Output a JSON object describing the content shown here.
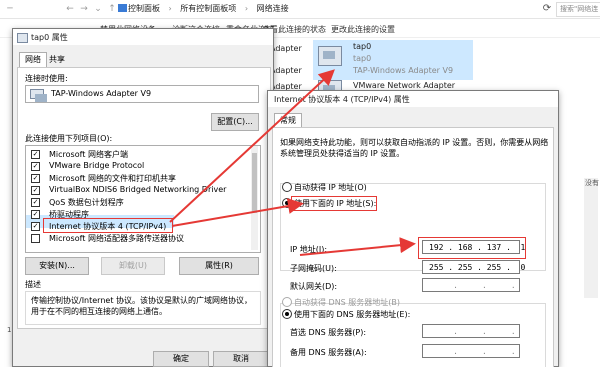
{
  "explorer": {
    "breadcrumb": [
      "控制面板",
      "所有控制面板项",
      "网络连接"
    ],
    "search_placeholder": "搜索\"网络连",
    "commands": [
      "禁用此网络设备",
      "诊断这个连接",
      "重命名此连接",
      "查看此连接的状态",
      "更改此连接的设置"
    ],
    "adapters": [
      {
        "name": "tap0",
        "status": "tap0",
        "device": "TAP-Windows Adapter V9"
      },
      {
        "name": "VMware Network Adapter",
        "status": "",
        "device": ""
      }
    ],
    "left_fragments": [
      "Adapter",
      "Adapter",
      "Adapter"
    ],
    "no_items": "没有",
    "status_num": "1"
  },
  "tap_dialog": {
    "title": "tap0 属性",
    "tabs": [
      "网络",
      "共享"
    ],
    "connect_using_label": "连接时使用:",
    "adapter_name": "TAP-Windows Adapter V9",
    "configure_button": "配置(C)...",
    "items_label": "此连接使用下列项目(O):",
    "items": [
      {
        "label": "Microsoft 网络客户端",
        "checked": true
      },
      {
        "label": "VMware Bridge Protocol",
        "checked": true
      },
      {
        "label": "Microsoft 网络的文件和打印机共享",
        "checked": true
      },
      {
        "label": "VirtualBox NDIS6 Bridged Networking Driver",
        "checked": true
      },
      {
        "label": "QoS 数据包计划程序",
        "checked": true
      },
      {
        "label": "桥驱动程序",
        "checked": true
      },
      {
        "label": "Internet 协议版本 4 (TCP/IPv4)",
        "checked": true
      },
      {
        "label": "Microsoft 网络适配器多路传送器协议",
        "checked": false
      }
    ],
    "install_button": "安装(N)...",
    "uninstall_button": "卸载(U)",
    "properties_button": "属性(R)",
    "description_label": "描述",
    "description_text": "传输控制协议/Internet 协议。该协议是默认的广域网络协议，用于在不同的相互连接的网络上通信。",
    "ok_button": "确定",
    "cancel_button": "取消"
  },
  "ipv4_dialog": {
    "title": "Internet 协议版本 4 (TCP/IPv4) 属性",
    "tab": "常规",
    "intro_line1": "如果网络支持此功能，则可以获取自动指派的 IP 设置。否则，你需要从网络",
    "intro_line2": "系统管理员处获得适当的 IP 设置。",
    "auto_ip_label": "自动获得 IP 地址(O)",
    "manual_ip_label": "使用下面的 IP 地址(S):",
    "ip_label": "IP 地址(I):",
    "ip_value": "192 . 168 . 137 .  1",
    "mask_label": "子网掩码(U):",
    "mask_value": "255 . 255 . 255 .  0",
    "gateway_label": "默认网关(D):",
    "gateway_value": "     .     .     .",
    "auto_dns_label": "自动获得 DNS 服务器地址(B)",
    "manual_dns_label": "使用下面的 DNS 服务器地址(E):",
    "dns1_label": "首选 DNS 服务器(P):",
    "dns1_value": "     .     .     .",
    "dns2_label": "备用 DNS 服务器(A):",
    "dns2_value": "     .     .     ."
  },
  "colors": {
    "highlight": "#cde8ff",
    "annotation": "#e53935"
  }
}
